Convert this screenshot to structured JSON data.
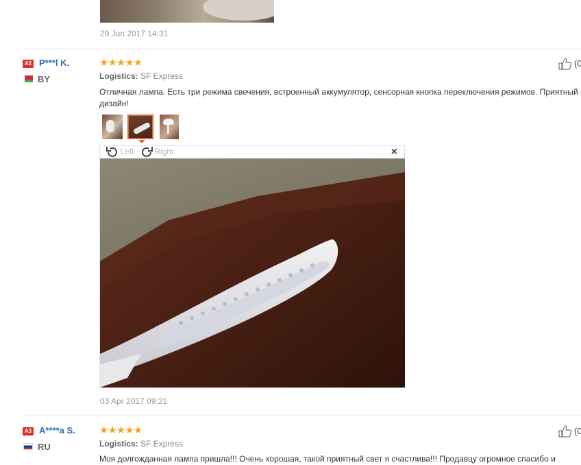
{
  "prev_review": {
    "date": "29 Jun 2017 14:31"
  },
  "reviews": [
    {
      "badge": "A2",
      "badge_color": "#d9302d",
      "name": "P***l K.",
      "country": "BY",
      "stars": "★★★★★",
      "logistics_label": "Logistics:",
      "logistics_value": "SF Express",
      "text": "Отличная лампа. Есть три режима свечения, встроенный аккумулятор, сенсорная кнопка переключения режимов. Приятный дизайн!",
      "helpful_count": "(0",
      "images_count": 3,
      "selected_image": 2,
      "viewer": {
        "left_label": "Left",
        "right_label": "Right",
        "close": "×"
      },
      "date": "03 Apr 2017 09:21"
    },
    {
      "badge": "A3",
      "badge_color": "#d9302d",
      "name": "A****a S.",
      "country": "RU",
      "stars": "★★★★★",
      "logistics_label": "Logistics:",
      "logistics_value": "SF Express",
      "text": "Моя долгожданная лампа пришла!!! Очень хорошая, такой приятный свет я счастлива!!! Продавцу огромное спасибо и",
      "helpful_count": "(0"
    }
  ],
  "icons": {
    "thumb": "thumbs-up-icon",
    "rotate_left": "rotate-left-icon",
    "rotate_right": "rotate-right-icon",
    "close": "close-icon",
    "flag_by": "flag-by-icon",
    "flag_ru": "flag-ru-icon"
  }
}
